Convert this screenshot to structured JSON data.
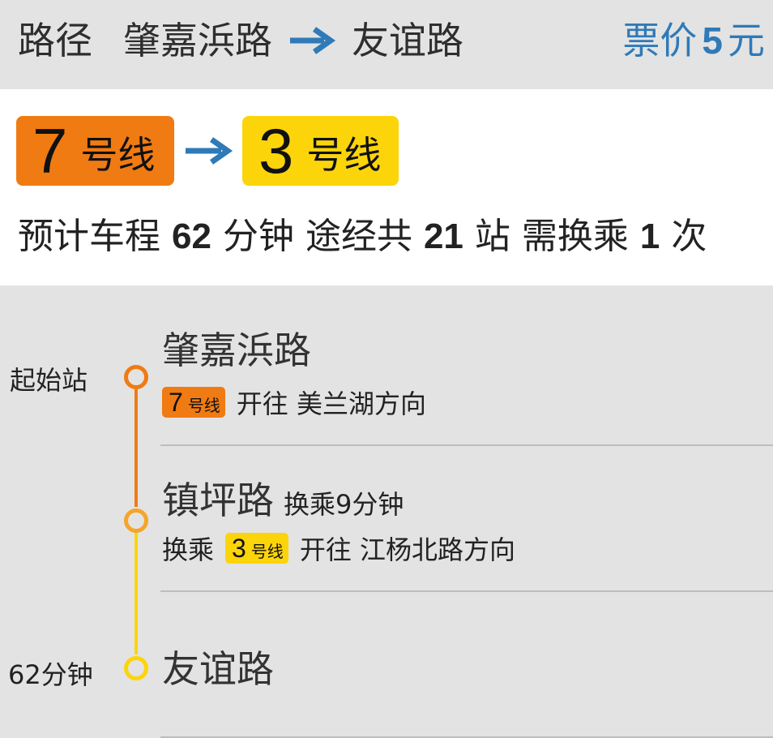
{
  "header": {
    "route_label": "路径",
    "from_station": "肇嘉浜路",
    "to_station": "友谊路",
    "fare_label": "票价",
    "fare_amount": "5",
    "fare_unit": "元",
    "arrow_icon": "right-arrow-icon",
    "fare_color": "#2f7ab8"
  },
  "summary": {
    "lines": [
      {
        "number": "7",
        "suffix": "号线",
        "color": "#f07b12"
      },
      {
        "number": "3",
        "suffix": "号线",
        "color": "#fcd40a"
      }
    ],
    "duration_prefix": "预计车程",
    "duration_value": "62",
    "duration_unit": "分钟",
    "stations_prefix": "途经共",
    "stations_value": "21",
    "stations_unit": "站",
    "transfers_prefix": "需换乘",
    "transfers_value": "1",
    "transfers_unit": "次"
  },
  "timeline": {
    "start_label": "起始站",
    "end_label": "62分钟",
    "stops": [
      {
        "name": "肇嘉浜路",
        "line_number": "7",
        "line_suffix": "号线",
        "direction": "开往 美兰湖方向"
      },
      {
        "name": "镇坪路",
        "transfer_note": "换乘9分钟",
        "transfer_prefix": "换乘",
        "line_number": "3",
        "line_suffix": "号线",
        "direction": "开往 江杨北路方向"
      },
      {
        "name": "友谊路"
      }
    ]
  }
}
